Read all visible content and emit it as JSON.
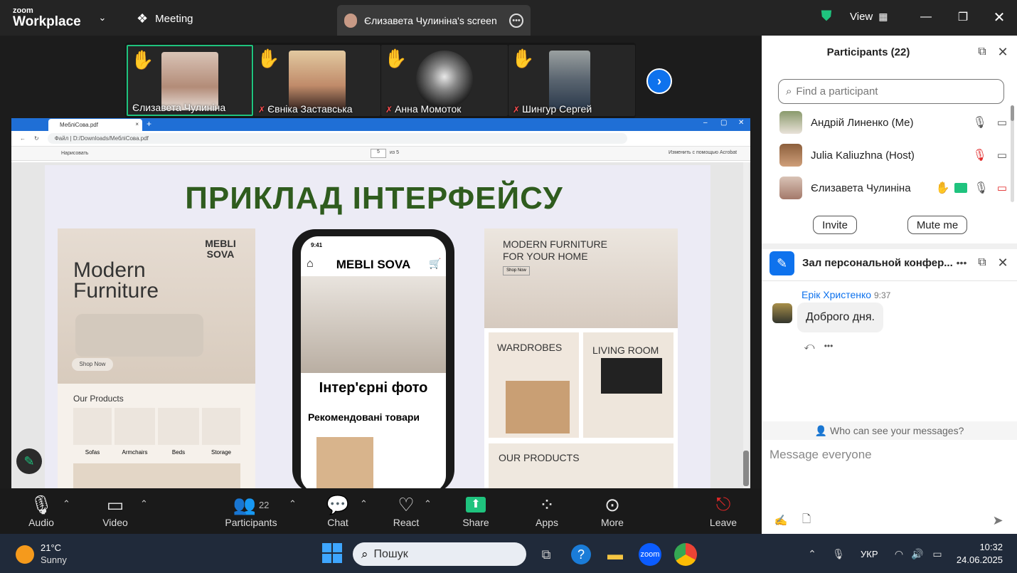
{
  "topbar": {
    "brand_top": "zoom",
    "brand_main": "Workplace",
    "meeting_label": "Meeting",
    "share_tab": "Єлизавета Чулиніна's screen",
    "view_label": "View"
  },
  "strip": [
    {
      "name": "Єлизавета Чулиніна",
      "active": true
    },
    {
      "name": "Євніка Заставська"
    },
    {
      "name": "Анна Момоток"
    },
    {
      "name": "Шингур Сергей"
    }
  ],
  "browser": {
    "tab_title": "МебліСова.pdf",
    "address": "Файл | D:/Downloads/МебліСова.pdf",
    "draw_label": "Нарисовать",
    "page_current": "5",
    "page_total": "из 5",
    "acrobat_label": "Изменить с помощью Acrobat"
  },
  "slide": {
    "heading": "ПРИКЛАД ІНТЕРФЕЙСУ",
    "left": {
      "brand": "MEBLI SOVA",
      "title": "Modern Furniture",
      "cta": "Shop Now",
      "products_title": "Our Products",
      "products": [
        "Sofas",
        "Armchairs",
        "Beds",
        "Storage"
      ]
    },
    "phone": {
      "time": "9:41",
      "brand": "MEBLI SOVA",
      "photos": "Інтер'єрні фото",
      "recommended": "Рекомендовані товари"
    },
    "right": {
      "hero": "MODERN FURNITURE FOR YOUR HOME",
      "cta": "Shop Now",
      "wardrobes": "WARDROBES",
      "living": "LIVING ROOM",
      "products": "OUR PRODUCTS"
    }
  },
  "participants": {
    "title": "Participants (22)",
    "search_placeholder": "Find a participant",
    "list": [
      {
        "name": "Андрій Линенко (Me)"
      },
      {
        "name": "Julia Kaliuzhna (Host)"
      },
      {
        "name": "Єлизавета Чулиніна"
      }
    ],
    "invite": "Invite",
    "mute_me": "Mute me"
  },
  "chat": {
    "title": "Зал персональной конфер...",
    "messages": [
      {
        "sender": "Ерік Христенко",
        "time": "9:37",
        "text": "Доброго дня."
      }
    ],
    "visibility": "Who can see your messages?",
    "input_placeholder": "Message everyone"
  },
  "toolbar": {
    "audio": "Audio",
    "video": "Video",
    "participants": "Participants",
    "participants_count": "22",
    "chat": "Chat",
    "react": "React",
    "share": "Share",
    "apps": "Apps",
    "more": "More",
    "leave": "Leave"
  },
  "taskbar": {
    "temp": "21°C",
    "weather": "Sunny",
    "search": "Пошук",
    "lang": "УКР",
    "time": "10:32",
    "date": "24.06.2025"
  },
  "colors": {
    "accent_green": "#1fc37e",
    "zoom_blue": "#0b5cff",
    "link_blue": "#0e72ed",
    "slide_heading": "#2f5c1e"
  }
}
